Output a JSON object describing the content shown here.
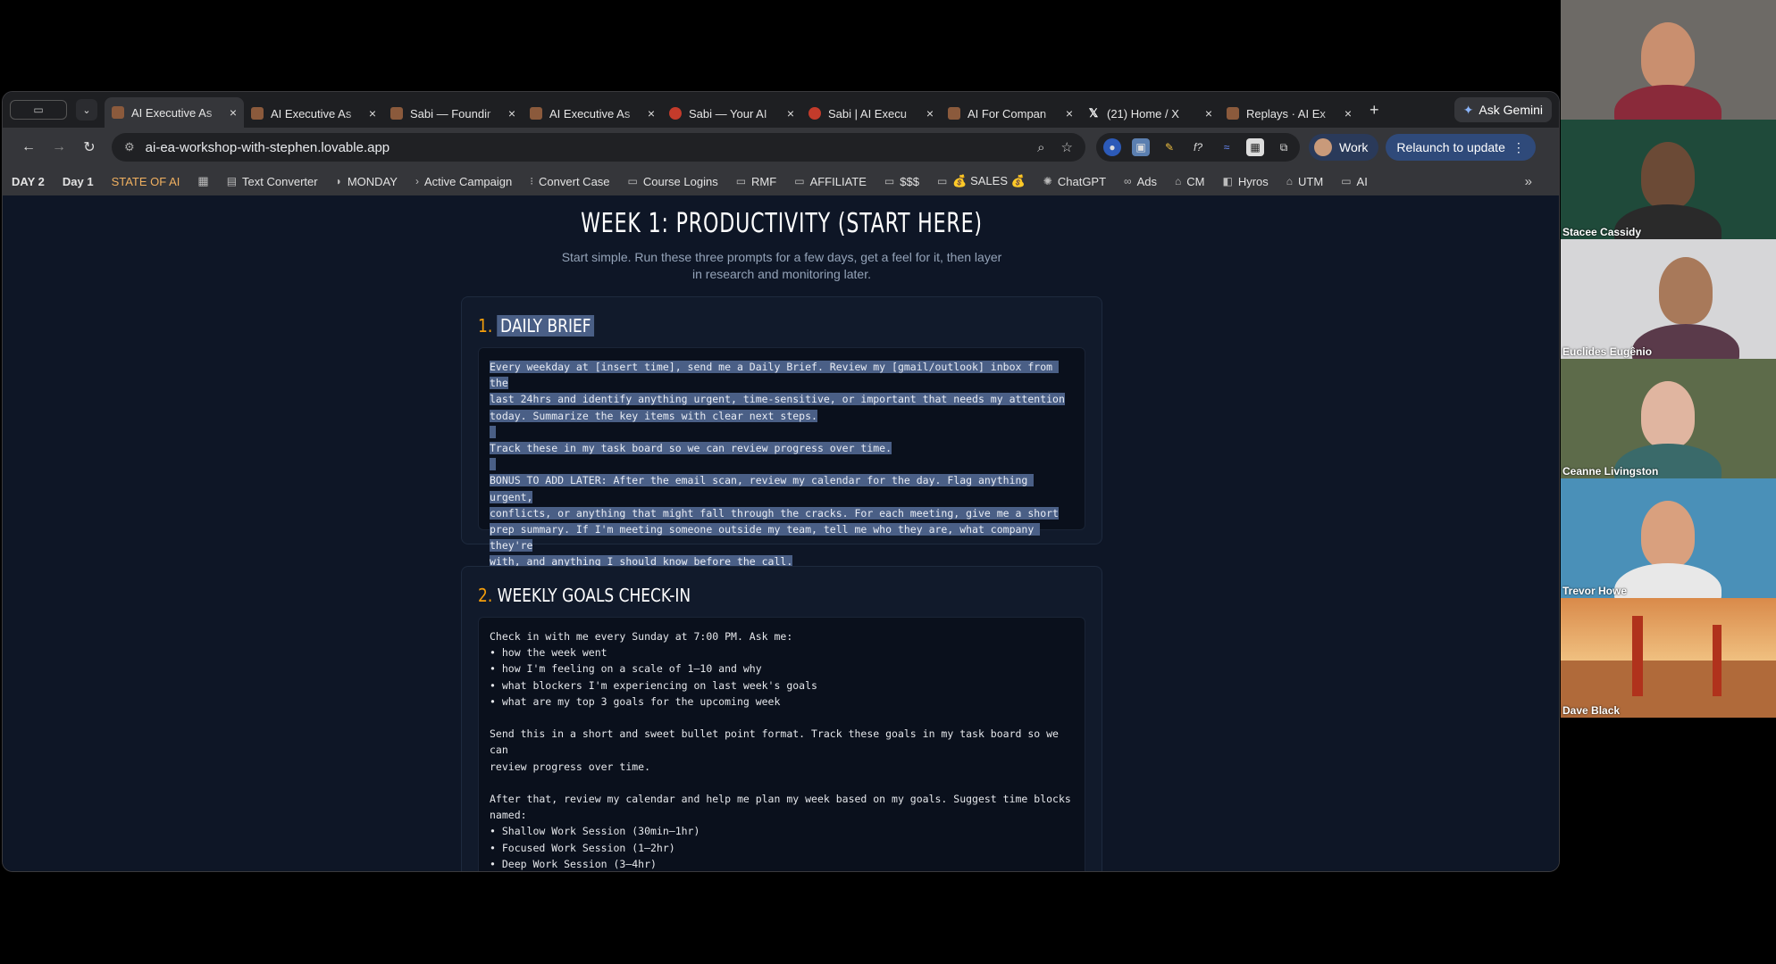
{
  "browser": {
    "tabs": [
      {
        "title": "AI Executive As",
        "active": true
      },
      {
        "title": "AI Executive As",
        "active": false
      },
      {
        "title": "Sabi — Foundir",
        "active": false
      },
      {
        "title": "AI Executive As",
        "active": false
      },
      {
        "title": "Sabi — Your AI",
        "active": false
      },
      {
        "title": "Sabi | AI Execu",
        "active": false
      },
      {
        "title": "AI For Compan",
        "active": false
      },
      {
        "title": "(21) Home / X",
        "active": false
      },
      {
        "title": "Replays · AI Ex",
        "active": false
      }
    ],
    "ask_gemini": "Ask Gemini",
    "url": "ai-ea-workshop-with-stephen.lovable.app",
    "profile": "Work",
    "relaunch": "Relaunch to update",
    "bookmarks": [
      {
        "label": "DAY 2",
        "style": "bold"
      },
      {
        "label": "Day 1",
        "style": "bold"
      },
      {
        "label": "STATE OF AI",
        "style": "orange"
      },
      {
        "label": "Text Converter",
        "icon": "page-icon"
      },
      {
        "label": "MONDAY",
        "icon": "monday-icon"
      },
      {
        "label": "Active Campaign",
        "icon": "activecampaign-icon"
      },
      {
        "label": "Convert Case",
        "icon": "convertcase-icon"
      },
      {
        "label": "Course Logins",
        "icon": "folder-icon"
      },
      {
        "label": "RMF",
        "icon": "folder-icon"
      },
      {
        "label": "AFFILIATE",
        "icon": "folder-icon"
      },
      {
        "label": "$$$",
        "icon": "folder-icon"
      },
      {
        "label": "💰 SALES 💰",
        "icon": "folder-icon"
      },
      {
        "label": "ChatGPT",
        "icon": "chatgpt-icon"
      },
      {
        "label": "Ads",
        "icon": "meta-icon"
      },
      {
        "label": "CM",
        "icon": "cm-icon"
      },
      {
        "label": "Hyros",
        "icon": "hyros-icon"
      },
      {
        "label": "UTM",
        "icon": "utm-icon"
      },
      {
        "label": "AI",
        "icon": "folder-icon"
      }
    ]
  },
  "page": {
    "title": "WEEK 1: PRODUCTIVITY (START HERE)",
    "subtitle": "Start simple. Run these three prompts for a few days, get a feel for it, then layer in research and monitoring later.",
    "sections": [
      {
        "number": "1.",
        "heading": "DAILY BRIEF",
        "prompt_lines": [
          "Every weekday at [insert time], send me a Daily Brief. Review my [gmail/outlook] inbox from the",
          "last 24hrs and identify anything urgent, time-sensitive, or important that needs my attention",
          "today. Summarize the key items with clear next steps.",
          "",
          "Track these in my task board so we can review progress over time.",
          "",
          "BONUS TO ADD LATER: After the email scan, review my calendar for the day. Flag anything urgent,",
          "conflicts, or anything that might fall through the cracks. For each meeting, give me a short",
          "prep summary. If I'm meeting someone outside my team, tell me who they are, what company they're",
          "with, and anything I should know before the call."
        ]
      },
      {
        "number": "2.",
        "heading": "WEEKLY GOALS CHECK-IN",
        "prompt_lines": [
          "Check in with me every Sunday at 7:00 PM. Ask me:",
          "• how the week went",
          "• how I'm feeling on a scale of 1–10 and why",
          "• what blockers I'm experiencing on last week's goals",
          "• what are my top 3 goals for the upcoming week",
          "",
          "Send this in a short and sweet bullet point format. Track these goals in my task board so we can",
          "review progress over time.",
          "",
          "After that, review my calendar and help me plan my week based on my goals. Suggest time blocks",
          "named:",
          "• Shallow Work Session (30min–1hr)",
          "• Focused Work Session (1–2hr)",
          "• Deep Work Session (3–4hr)"
        ]
      }
    ]
  },
  "participants": [
    {
      "name": "",
      "bg": "#6d6a66"
    },
    {
      "name": "Stacee Cassidy",
      "bg": "#1f4a3a"
    },
    {
      "name": "Euclides Eugênio",
      "bg": "#d6d6d8"
    },
    {
      "name": "Ceanne Livingston",
      "bg": "#5d6b4a"
    },
    {
      "name": "Trevor Howe",
      "bg": "#4a90b8"
    },
    {
      "name": "Dave Black",
      "bg": "#b06a3a"
    }
  ],
  "colors": {
    "accent_number": "#f59e0b",
    "selection": "#4a5f86",
    "page_bg": "#0e1626"
  }
}
